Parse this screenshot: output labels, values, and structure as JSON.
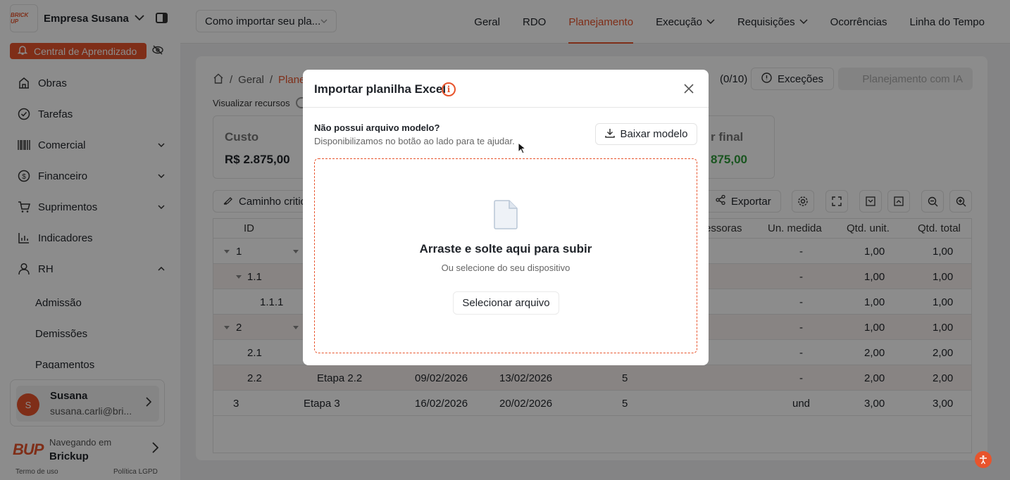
{
  "sidebar": {
    "company_name": "Empresa Susana",
    "logo_text": "BRICK UP",
    "learning_center": "Central de Aprendizado",
    "items": [
      {
        "label": "Obras",
        "icon": "building-icon"
      },
      {
        "label": "Tarefas",
        "icon": "check-circle-icon"
      },
      {
        "label": "Comercial",
        "icon": "barcode-icon"
      },
      {
        "label": "Financeiro",
        "icon": "dollar-circle-icon"
      },
      {
        "label": "Suprimentos",
        "icon": "cart-icon"
      },
      {
        "label": "Indicadores",
        "icon": "bar-chart-icon"
      },
      {
        "label": "RH",
        "icon": "person-icon"
      }
    ],
    "rh_subitems": [
      "Admissão",
      "Demissões",
      "Pagamentos"
    ],
    "user": {
      "initial": "S",
      "name": "Susana",
      "email": "susana.carli@bri..."
    },
    "navigating_label": "Navegando em",
    "navigating_target": "Brickup",
    "footer_logo": "BUP",
    "terms": "Termo de uso",
    "privacy": "Política LGPD"
  },
  "topbar": {
    "project_select": "Como importar seu pla...",
    "tabs": [
      {
        "label": "Geral",
        "dropdown": false,
        "active": false
      },
      {
        "label": "RDO",
        "dropdown": false,
        "active": false
      },
      {
        "label": "Planejamento",
        "dropdown": false,
        "active": true
      },
      {
        "label": "Execução",
        "dropdown": true,
        "active": false
      },
      {
        "label": "Requisições",
        "dropdown": true,
        "active": false
      },
      {
        "label": "Ocorrências",
        "dropdown": false,
        "active": false
      },
      {
        "label": "Linha do Tempo",
        "dropdown": false,
        "active": false
      }
    ]
  },
  "page": {
    "breadcrumb": [
      "Geral",
      "Plane"
    ],
    "visualizar_recursos": "Visualizar recursos",
    "counter": "(0/10)",
    "excecoes": "Exceções",
    "planejamento_ia": "Planejamento com IA",
    "stat_custo_label": "Custo",
    "stat_custo_value": "R$ 2.875,00",
    "stat_final_label": "r final",
    "stat_final_value": "875,00",
    "caminho_critico": "Caminho critic",
    "exportar": "Exportar",
    "table": {
      "headers": {
        "id": "ID",
        "predecessoras": "essoras",
        "un_medida": "Un. medida",
        "qtd_unit": "Qtd. unit.",
        "qtd_total": "Qtd. total"
      },
      "rows": [
        {
          "id": "1",
          "name": "",
          "start": "",
          "end": "",
          "dur": "",
          "un": "-",
          "unit": "1,00",
          "total": "1,00"
        },
        {
          "id": "1.1",
          "name": "",
          "start": "",
          "end": "",
          "dur": "",
          "un": "-",
          "unit": "1,00",
          "total": "1,00"
        },
        {
          "id": "1.1.1",
          "name": "",
          "start": "",
          "end": "",
          "dur": "",
          "un": "-",
          "unit": "1,00",
          "total": "1,00"
        },
        {
          "id": "2",
          "name": "",
          "start": "",
          "end": "",
          "dur": "",
          "un": "-",
          "unit": "1,00",
          "total": "1,00"
        },
        {
          "id": "2.1",
          "name": "",
          "start": "",
          "end": "",
          "dur": "",
          "un": "-",
          "unit": "2,00",
          "total": "2,00"
        },
        {
          "id": "2.2",
          "name": "Etapa 2.2",
          "start": "09/02/2026",
          "end": "13/02/2026",
          "dur": "5",
          "un": "-",
          "unit": "2,00",
          "total": "2,00"
        },
        {
          "id": "3",
          "name": "Etapa 3",
          "start": "16/02/2026",
          "end": "20/02/2026",
          "dur": "5",
          "un": "und",
          "unit": "3,00",
          "total": "3,00"
        }
      ]
    }
  },
  "modal": {
    "title": "Importar planilha Excel",
    "no_model_title": "Não possui arquivo modelo?",
    "no_model_sub": "Disponibilizamos no botão ao lado para te ajudar.",
    "download_button": "Baixar modelo",
    "drop_title": "Arraste e solte aqui para subir",
    "drop_sub": "Ou selecione do seu dispositivo",
    "select_button": "Selecionar arquivo"
  },
  "colors": {
    "accent": "#e8542c",
    "green": "#2e9b3a"
  }
}
